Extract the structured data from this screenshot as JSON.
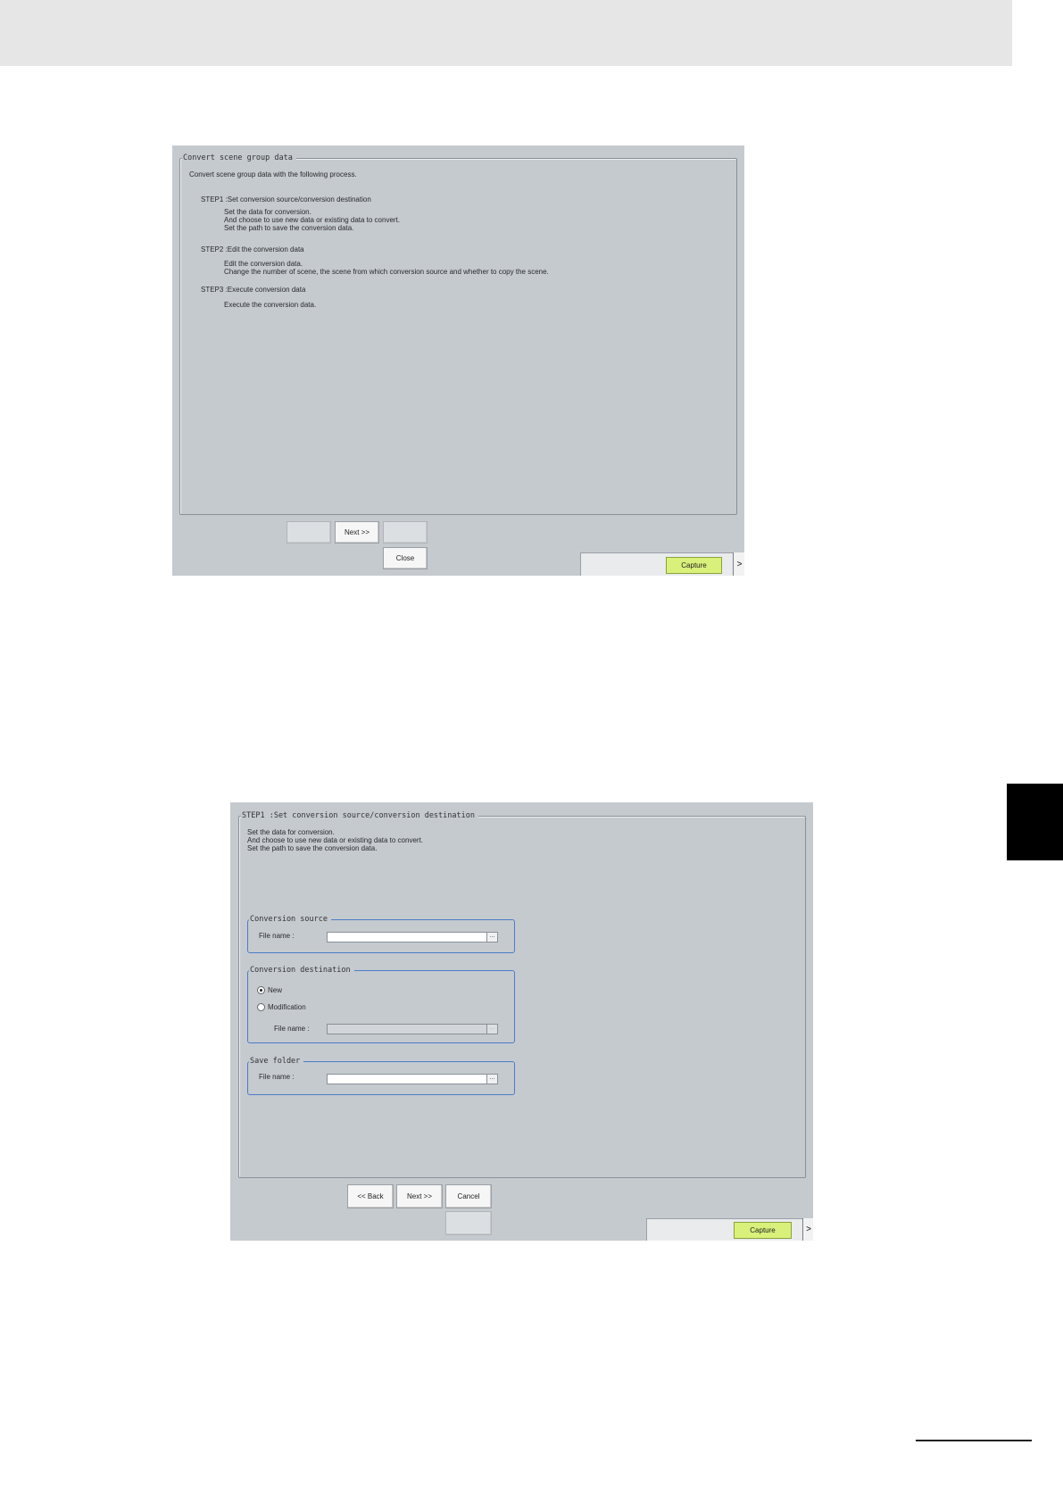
{
  "dialog1": {
    "legend": "Convert scene group data",
    "intro": "Convert scene group data with the following process.",
    "steps": [
      {
        "title": "STEP1 :Set conversion source/conversion destination",
        "lines": [
          "Set the data for conversion.",
          "And choose to use new data or existing data to convert.",
          "Set the path to save the conversion data."
        ]
      },
      {
        "title": "STEP2 :Edit the conversion data",
        "lines": [
          "Edit the conversion data.",
          "Change the number of scene, the scene from which conversion source and whether to copy the scene."
        ]
      },
      {
        "title": "STEP3 :Execute conversion data",
        "lines": [
          "Execute the conversion data."
        ]
      }
    ],
    "buttons": {
      "back": "",
      "next": "Next >>",
      "cancel": "",
      "close": "Close"
    },
    "capture_label": "Capture",
    "arrow_label": ">"
  },
  "dialog2": {
    "legend": "STEP1 :Set conversion source/conversion destination",
    "desc": [
      "Set the data for conversion.",
      "And choose to use new data or existing data to convert.",
      "Set the path to save the conversion data."
    ],
    "source": {
      "legend": "Conversion source",
      "file_label": "File name :",
      "file_value": "",
      "browse": "..."
    },
    "destination": {
      "legend": "Conversion destination",
      "option_new": "New",
      "option_modification": "Modification",
      "selected": "New",
      "file_label": "File name :",
      "file_value": "",
      "browse": "..."
    },
    "save_folder": {
      "legend": "Save folder",
      "file_label": "File name :",
      "file_value": "",
      "browse": "..."
    },
    "buttons": {
      "back": "<< Back",
      "next": "Next >>",
      "cancel": "Cancel",
      "extra": ""
    },
    "capture_label": "Capture",
    "arrow_label": ">"
  }
}
